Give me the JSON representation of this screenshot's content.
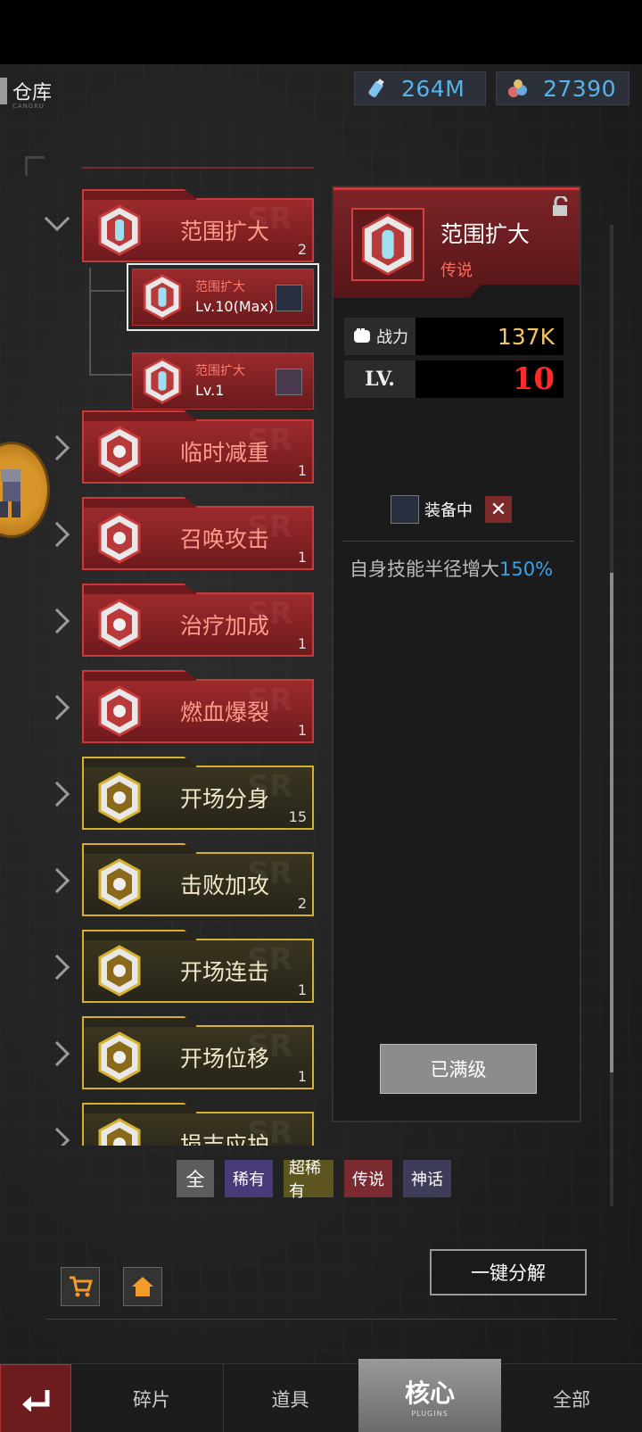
{
  "header": {
    "title": "仓库",
    "subtitle": "CANGKU",
    "currency_bottles": "264M",
    "currency_gems": "27390"
  },
  "list": {
    "expanded_card": {
      "name": "范围扩大",
      "count": "2"
    },
    "sub_items": [
      {
        "name": "范围扩大",
        "level": "Lv.10(Max)"
      },
      {
        "name": "范围扩大",
        "level": "Lv.1"
      }
    ],
    "cards": [
      {
        "name": "临时减重",
        "count": "1",
        "rarity": "red"
      },
      {
        "name": "召唤攻击",
        "count": "1",
        "rarity": "red"
      },
      {
        "name": "治疗加成",
        "count": "1",
        "rarity": "red"
      },
      {
        "name": "燃血爆裂",
        "count": "1",
        "rarity": "red"
      },
      {
        "name": "开场分身",
        "count": "15",
        "rarity": "gold"
      },
      {
        "name": "击败加攻",
        "count": "2",
        "rarity": "gold"
      },
      {
        "name": "开场连击",
        "count": "1",
        "rarity": "gold"
      },
      {
        "name": "开场位移",
        "count": "1",
        "rarity": "gold"
      },
      {
        "name": "损吉应护",
        "count": "",
        "rarity": "gold"
      }
    ]
  },
  "detail": {
    "name": "范围扩大",
    "rarity": "传说",
    "power_label": "战力",
    "power_value": "137K",
    "level_label": "LV.",
    "level_value": "10",
    "equipped_label": "装备中",
    "remove_symbol": "✕",
    "description": "自身技能半径增大",
    "description_value": "150%",
    "max_button": "已满级"
  },
  "filters": [
    "全",
    "稀有",
    "超稀有",
    "传说",
    "神话"
  ],
  "actions": {
    "decompose": "一键分解"
  },
  "nav": {
    "tabs": [
      "碎片",
      "道具",
      "核心",
      "全部"
    ],
    "active_sub": "PLUGINS"
  },
  "colors": {
    "legend_red": "#c93a3a",
    "rare_gold": "#d4b22d",
    "accent_blue": "#5ab2ea"
  }
}
